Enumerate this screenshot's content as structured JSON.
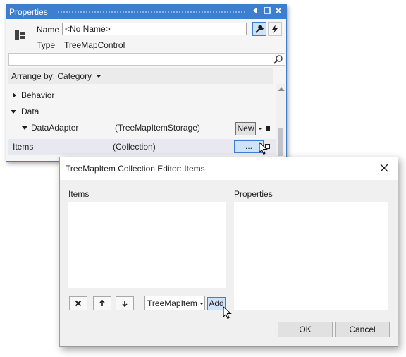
{
  "properties_window": {
    "title": "Properties",
    "name_label": "Name",
    "name_value": "<No Name>",
    "type_label": "Type",
    "type_value": "TreeMapControl",
    "search_placeholder": "",
    "arrange_by": "Arrange by: Category",
    "rows": [
      {
        "label": "Behavior"
      },
      {
        "label": "Data"
      },
      {
        "label": "DataAdapter",
        "value": "(TreeMapItemStorage)",
        "button": "New"
      },
      {
        "label": "Items",
        "value": "(Collection)",
        "button": "..."
      }
    ]
  },
  "collection_editor": {
    "title": "TreeMapItem Collection Editor: Items",
    "items_label": "Items",
    "properties_label": "Properties",
    "item_type": "TreeMapItem",
    "add_label": "Add",
    "ok_label": "OK",
    "cancel_label": "Cancel"
  },
  "colors": {
    "accent": "#3c7ed0",
    "selection": "#cfe3f8",
    "window_bg": "#f5f5f5",
    "dialog_bg": "#f0f0f0"
  },
  "icons": [
    "pin-icon",
    "maximize-icon",
    "close-icon",
    "object-icon",
    "wrench-icon",
    "lightning-icon",
    "search-icon",
    "delete-icon",
    "arrow-up-icon",
    "arrow-down-icon",
    "mouse-cursor-icon"
  ]
}
